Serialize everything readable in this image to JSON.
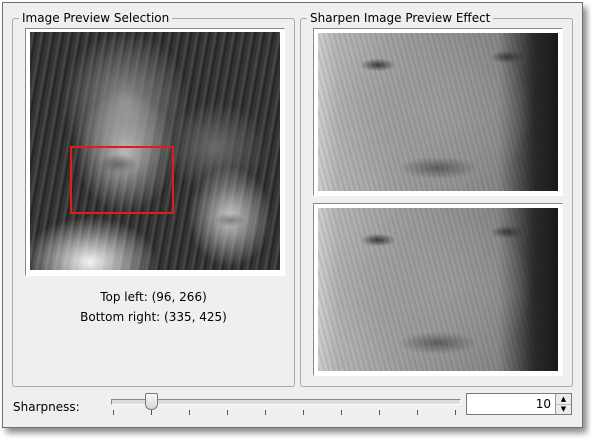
{
  "left_panel": {
    "title": "Image Preview Selection",
    "top_left_text": "Top left: (96, 266)",
    "bottom_right_text": "Bottom right: (335, 425)"
  },
  "right_panel": {
    "title": "Sharpen Image Preview Effect"
  },
  "sharpness": {
    "label": "Sharpness:",
    "value": "10",
    "slider_fraction": 0.1,
    "up_glyph": "▲",
    "down_glyph": "▼"
  },
  "colors": {
    "selection_rect": "#e21b1b",
    "window_bg": "#efefef"
  }
}
